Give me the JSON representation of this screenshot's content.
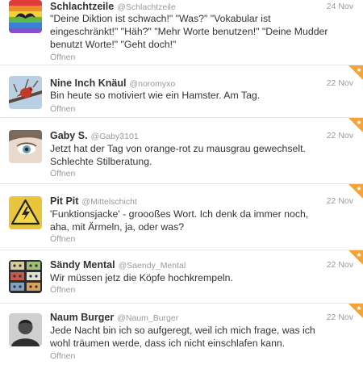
{
  "colors": {
    "favorite_corner": "#f2a33a",
    "name": "#333333",
    "meta": "#999999",
    "divider": "#e8e8e8"
  },
  "tweets": [
    {
      "name": "Schlachtzeile",
      "handle": "@Schlachtzeile",
      "time": "24 Nov",
      "lines": [
        "\"Deine Diktion ist schwach!\" \"Was?\" \"Vokabular ist",
        "eingeschränkt!\" \"Häh?\" \"Mehr Worte benutzen!\" \"Deine Mudder",
        "benutzt Worte!\" \"Geht doch!\""
      ],
      "open_label": "Öffnen",
      "avatar_icon": "rainbow-mustache-avatar"
    },
    {
      "name": "Nine Inch Knäul",
      "handle": "@noromyxo",
      "time": "22 Nov",
      "lines": [
        "Bin heute so motiviert wie ein Hamster. Am Tag."
      ],
      "open_label": "Öffnen",
      "avatar_icon": "bird-on-branch-avatar"
    },
    {
      "name": "Gaby S.",
      "handle": "@Gaby3101",
      "time": "22 Nov",
      "lines": [
        "Jetzt hat der Tag von orange-rot zu mausgrau gewechselt.",
        "Schlechte Stilberatung."
      ],
      "open_label": "Öffnen",
      "avatar_icon": "face-closeup-avatar"
    },
    {
      "name": "Pit Pit",
      "handle": "@Mittelschicht",
      "time": "22 Nov",
      "lines": [
        "'Funktionsjacke' - groooßes Wort. Ich denk da immer noch,",
        "aha, mit Ärmeln, ja, oder was?"
      ],
      "open_label": "Öffnen",
      "avatar_icon": "warning-sign-avatar"
    },
    {
      "name": "Sändy Mental",
      "handle": "@Saendy_Mental",
      "time": "22 Nov",
      "lines": [
        "Wir müssen jetz die Köpfe hochkrempeln."
      ],
      "open_label": "Öffnen",
      "avatar_icon": "cassette-tapes-avatar"
    },
    {
      "name": "Naum Burger",
      "handle": "@Naum_Burger",
      "time": "22 Nov",
      "lines": [
        "Jede Nacht bin ich so aufgeregt, weil ich mich frage, was ich",
        "wohl träumen werde, dass ich nicht einschlafen kann."
      ],
      "open_label": "Öffnen",
      "avatar_icon": "portrait-bw-avatar"
    }
  ]
}
